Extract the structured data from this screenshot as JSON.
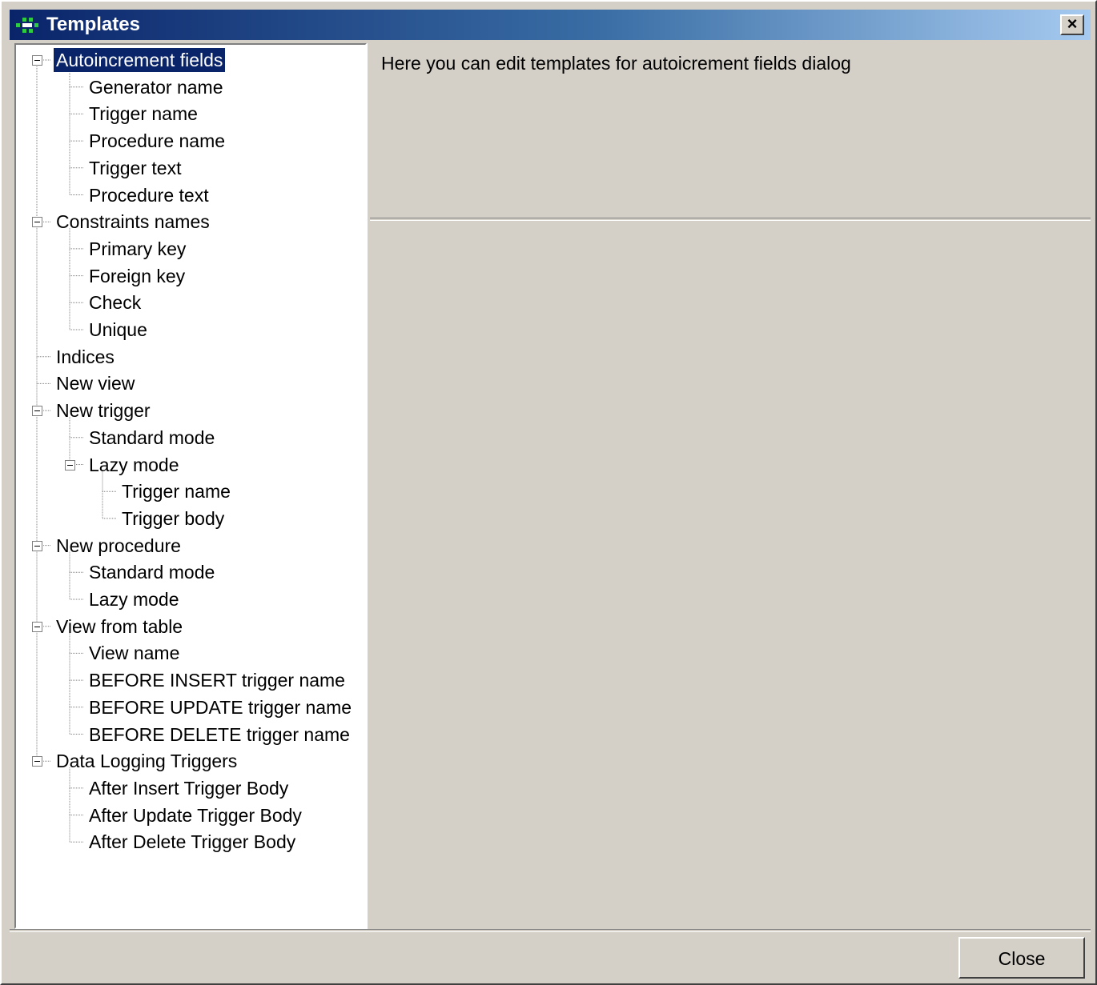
{
  "window": {
    "title": "Templates",
    "close_glyph": "×"
  },
  "tree": {
    "selected_item": "Autoincrement fields",
    "items": [
      {
        "label": "Autoincrement fields",
        "level": 0,
        "expanded": true
      },
      {
        "label": "Generator name",
        "level": 1
      },
      {
        "label": "Trigger name",
        "level": 1
      },
      {
        "label": "Procedure name",
        "level": 1
      },
      {
        "label": "Trigger text",
        "level": 1
      },
      {
        "label": "Procedure text",
        "level": 1
      },
      {
        "label": "Constraints names",
        "level": 0,
        "expanded": true
      },
      {
        "label": "Primary key",
        "level": 1
      },
      {
        "label": "Foreign key",
        "level": 1
      },
      {
        "label": "Check",
        "level": 1
      },
      {
        "label": "Unique",
        "level": 1
      },
      {
        "label": "Indices",
        "level": 0
      },
      {
        "label": "New view",
        "level": 0
      },
      {
        "label": "New trigger",
        "level": 0,
        "expanded": true
      },
      {
        "label": "Standard mode",
        "level": 1
      },
      {
        "label": "Lazy mode",
        "level": 1,
        "expanded": true
      },
      {
        "label": "Trigger name",
        "level": 2
      },
      {
        "label": "Trigger body",
        "level": 2
      },
      {
        "label": "New procedure",
        "level": 0,
        "expanded": true
      },
      {
        "label": "Standard mode",
        "level": 1
      },
      {
        "label": "Lazy mode",
        "level": 1
      },
      {
        "label": "View from table",
        "level": 0,
        "expanded": true
      },
      {
        "label": "View name",
        "level": 1
      },
      {
        "label": "BEFORE INSERT trigger name",
        "level": 1
      },
      {
        "label": "BEFORE UPDATE trigger name",
        "level": 1
      },
      {
        "label": "BEFORE DELETE trigger name",
        "level": 1
      },
      {
        "label": "Data Logging Triggers",
        "level": 0,
        "expanded": true
      },
      {
        "label": "After Insert Trigger Body",
        "level": 1
      },
      {
        "label": "After Update Trigger Body",
        "level": 1
      },
      {
        "label": "After Delete Trigger Body",
        "level": 1
      }
    ]
  },
  "description": {
    "text": "Here you can edit templates for autoicrement fields dialog"
  },
  "footer": {
    "close_label": "Close"
  },
  "icons": {
    "app": "templates-app-icon",
    "expander": "minus-box-icon"
  },
  "colors": {
    "selection": "#0a246a",
    "titlebar_start": "#0a246a",
    "titlebar_end": "#a6caf0",
    "face": "#d4d0c8"
  }
}
